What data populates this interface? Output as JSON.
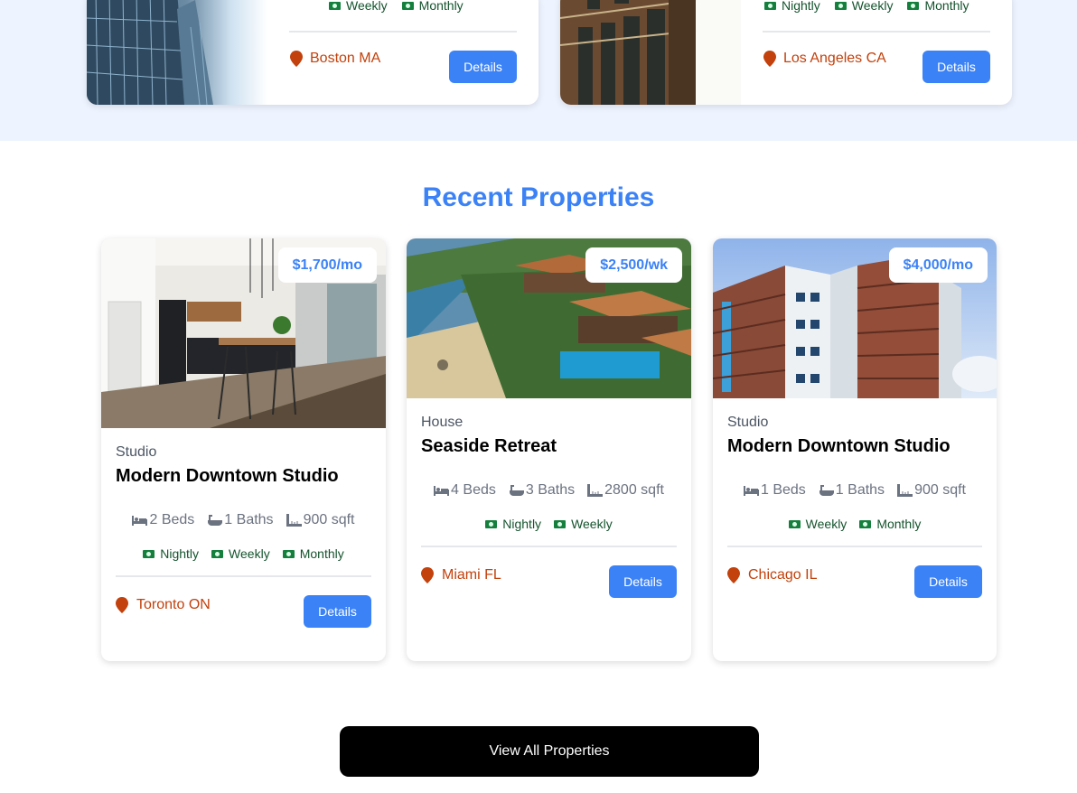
{
  "featured": [
    {
      "rates": [
        "Weekly",
        "Monthly"
      ],
      "location": "Boston MA",
      "details_label": "Details",
      "image_icon": "office-building-image"
    },
    {
      "rates": [
        "Nightly",
        "Weekly",
        "Monthly"
      ],
      "location": "Los Angeles CA",
      "details_label": "Details",
      "image_icon": "brick-building-image"
    }
  ],
  "recent": {
    "title": "Recent Properties",
    "cards": [
      {
        "price": "$1,700/mo",
        "type": "Studio",
        "name": "Modern Downtown Studio",
        "beds": "2 Beds",
        "baths": "1 Baths",
        "sqft": "900 sqft",
        "rates": [
          "Nightly",
          "Weekly",
          "Monthly"
        ],
        "location": "Toronto ON",
        "details_label": "Details"
      },
      {
        "price": "$2,500/wk",
        "type": "House",
        "name": "Seaside Retreat",
        "beds": "4 Beds",
        "baths": "3 Baths",
        "sqft": "2800 sqft",
        "rates": [
          "Nightly",
          "Weekly"
        ],
        "location": "Miami FL",
        "details_label": "Details"
      },
      {
        "price": "$4,000/mo",
        "type": "Studio",
        "name": "Modern Downtown Studio",
        "beds": "1 Beds",
        "baths": "1 Baths",
        "sqft": "900 sqft",
        "rates": [
          "Weekly",
          "Monthly"
        ],
        "location": "Chicago IL",
        "details_label": "Details"
      }
    ]
  },
  "view_all_label": "View All Properties",
  "colors": {
    "accent": "#3b82f6",
    "location": "#c2410c",
    "rate_text": "#14532d",
    "band_bg": "#eef4ff"
  }
}
